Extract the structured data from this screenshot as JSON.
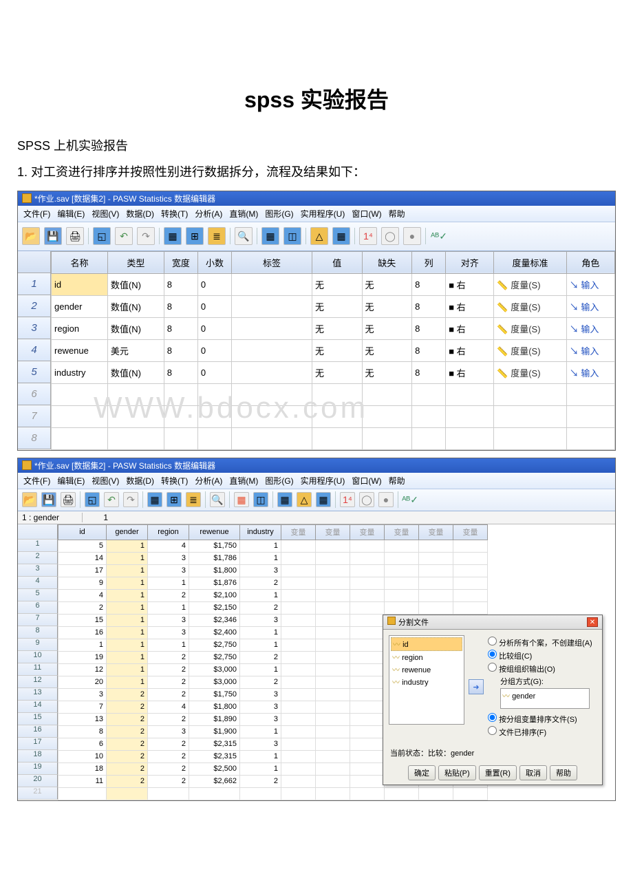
{
  "doc": {
    "title": "spss 实验报告",
    "line1": "SPSS 上机实验报告",
    "line2": "1. 对工资进行排序并按照性别进行数据拆分，流程及结果如下："
  },
  "watermark": "WWW.bdocx.com",
  "win1": {
    "title": "*作业.sav [数据集2] - PASW Statistics 数据编辑器",
    "menus": [
      "文件(F)",
      "编辑(E)",
      "视图(V)",
      "数据(D)",
      "转换(T)",
      "分析(A)",
      "直销(M)",
      "图形(G)",
      "实用程序(U)",
      "窗口(W)",
      "帮助"
    ],
    "cols": [
      "名称",
      "类型",
      "宽度",
      "小数",
      "标签",
      "值",
      "缺失",
      "列",
      "对齐",
      "度量标准",
      "角色"
    ],
    "rows": [
      {
        "n": "1",
        "name": "id",
        "type": "数值(N)",
        "w": "8",
        "d": "0",
        "lab": "",
        "val": "无",
        "mis": "无",
        "col": "8",
        "align": "■ 右",
        "meas": "度量(S)",
        "role": "输入",
        "sel": true
      },
      {
        "n": "2",
        "name": "gender",
        "type": "数值(N)",
        "w": "8",
        "d": "0",
        "lab": "",
        "val": "无",
        "mis": "无",
        "col": "8",
        "align": "■ 右",
        "meas": "度量(S)",
        "role": "输入"
      },
      {
        "n": "3",
        "name": "region",
        "type": "数值(N)",
        "w": "8",
        "d": "0",
        "lab": "",
        "val": "无",
        "mis": "无",
        "col": "8",
        "align": "■ 右",
        "meas": "度量(S)",
        "role": "输入"
      },
      {
        "n": "4",
        "name": "rewenue",
        "type": "美元",
        "w": "8",
        "d": "0",
        "lab": "",
        "val": "无",
        "mis": "无",
        "col": "8",
        "align": "■ 右",
        "meas": "度量(S)",
        "role": "输入"
      },
      {
        "n": "5",
        "name": "industry",
        "type": "数值(N)",
        "w": "8",
        "d": "0",
        "lab": "",
        "val": "无",
        "mis": "无",
        "col": "8",
        "align": "■ 右",
        "meas": "度量(S)",
        "role": "输入"
      }
    ],
    "empty_rows": [
      "6",
      "7",
      "8"
    ]
  },
  "win2": {
    "title": "*作业.sav [数据集2] - PASW Statistics 数据编辑器",
    "menus": [
      "文件(F)",
      "编辑(E)",
      "视图(V)",
      "数据(D)",
      "转换(T)",
      "分析(A)",
      "直销(M)",
      "图形(G)",
      "实用程序(U)",
      "窗口(W)",
      "帮助"
    ],
    "status_label": "1 : gender",
    "status_val": "1",
    "cols": [
      "id",
      "gender",
      "region",
      "rewenue",
      "industry"
    ],
    "extra_cols": [
      "变量",
      "变量",
      "变量",
      "变量",
      "变量",
      "变量"
    ],
    "rows": [
      {
        "n": "1",
        "id": "5",
        "g": "1",
        "r": "4",
        "rev": "$1,750",
        "ind": "1"
      },
      {
        "n": "2",
        "id": "14",
        "g": "1",
        "r": "3",
        "rev": "$1,786",
        "ind": "1"
      },
      {
        "n": "3",
        "id": "17",
        "g": "1",
        "r": "3",
        "rev": "$1,800",
        "ind": "3"
      },
      {
        "n": "4",
        "id": "9",
        "g": "1",
        "r": "1",
        "rev": "$1,876",
        "ind": "2"
      },
      {
        "n": "5",
        "id": "4",
        "g": "1",
        "r": "2",
        "rev": "$2,100",
        "ind": "1"
      },
      {
        "n": "6",
        "id": "2",
        "g": "1",
        "r": "1",
        "rev": "$2,150",
        "ind": "2"
      },
      {
        "n": "7",
        "id": "15",
        "g": "1",
        "r": "3",
        "rev": "$2,346",
        "ind": "3"
      },
      {
        "n": "8",
        "id": "16",
        "g": "1",
        "r": "3",
        "rev": "$2,400",
        "ind": "1"
      },
      {
        "n": "9",
        "id": "1",
        "g": "1",
        "r": "1",
        "rev": "$2,750",
        "ind": "1"
      },
      {
        "n": "10",
        "id": "19",
        "g": "1",
        "r": "2",
        "rev": "$2,750",
        "ind": "2"
      },
      {
        "n": "11",
        "id": "12",
        "g": "1",
        "r": "2",
        "rev": "$3,000",
        "ind": "1"
      },
      {
        "n": "12",
        "id": "20",
        "g": "1",
        "r": "2",
        "rev": "$3,000",
        "ind": "2"
      },
      {
        "n": "13",
        "id": "3",
        "g": "2",
        "r": "2",
        "rev": "$1,750",
        "ind": "3"
      },
      {
        "n": "14",
        "id": "7",
        "g": "2",
        "r": "4",
        "rev": "$1,800",
        "ind": "3"
      },
      {
        "n": "15",
        "id": "13",
        "g": "2",
        "r": "2",
        "rev": "$1,890",
        "ind": "3"
      },
      {
        "n": "16",
        "id": "8",
        "g": "2",
        "r": "3",
        "rev": "$1,900",
        "ind": "1"
      },
      {
        "n": "17",
        "id": "6",
        "g": "2",
        "r": "2",
        "rev": "$2,315",
        "ind": "3"
      },
      {
        "n": "18",
        "id": "10",
        "g": "2",
        "r": "2",
        "rev": "$2,315",
        "ind": "1"
      },
      {
        "n": "19",
        "id": "18",
        "g": "2",
        "r": "2",
        "rev": "$2,500",
        "ind": "1"
      },
      {
        "n": "20",
        "id": "11",
        "g": "2",
        "r": "2",
        "rev": "$2,662",
        "ind": "2"
      }
    ],
    "last_row": "21"
  },
  "dialog": {
    "title": "分割文件",
    "vars": [
      "id",
      "region",
      "rewenue",
      "industry"
    ],
    "opt_analyze": "分析所有个案，不创建组(A)",
    "opt_compare": "比较组(C)",
    "opt_organize": "按组组织输出(O)",
    "groups_label": "分组方式(G):",
    "group_var": "gender",
    "opt_sort": "按分组变量排序文件(S)",
    "opt_sorted": "文件已排序(F)",
    "status": "当前状态：比较：gender",
    "btn_ok": "确定",
    "btn_paste": "粘贴(P)",
    "btn_reset": "重置(R)",
    "btn_cancel": "取消",
    "btn_help": "帮助"
  }
}
